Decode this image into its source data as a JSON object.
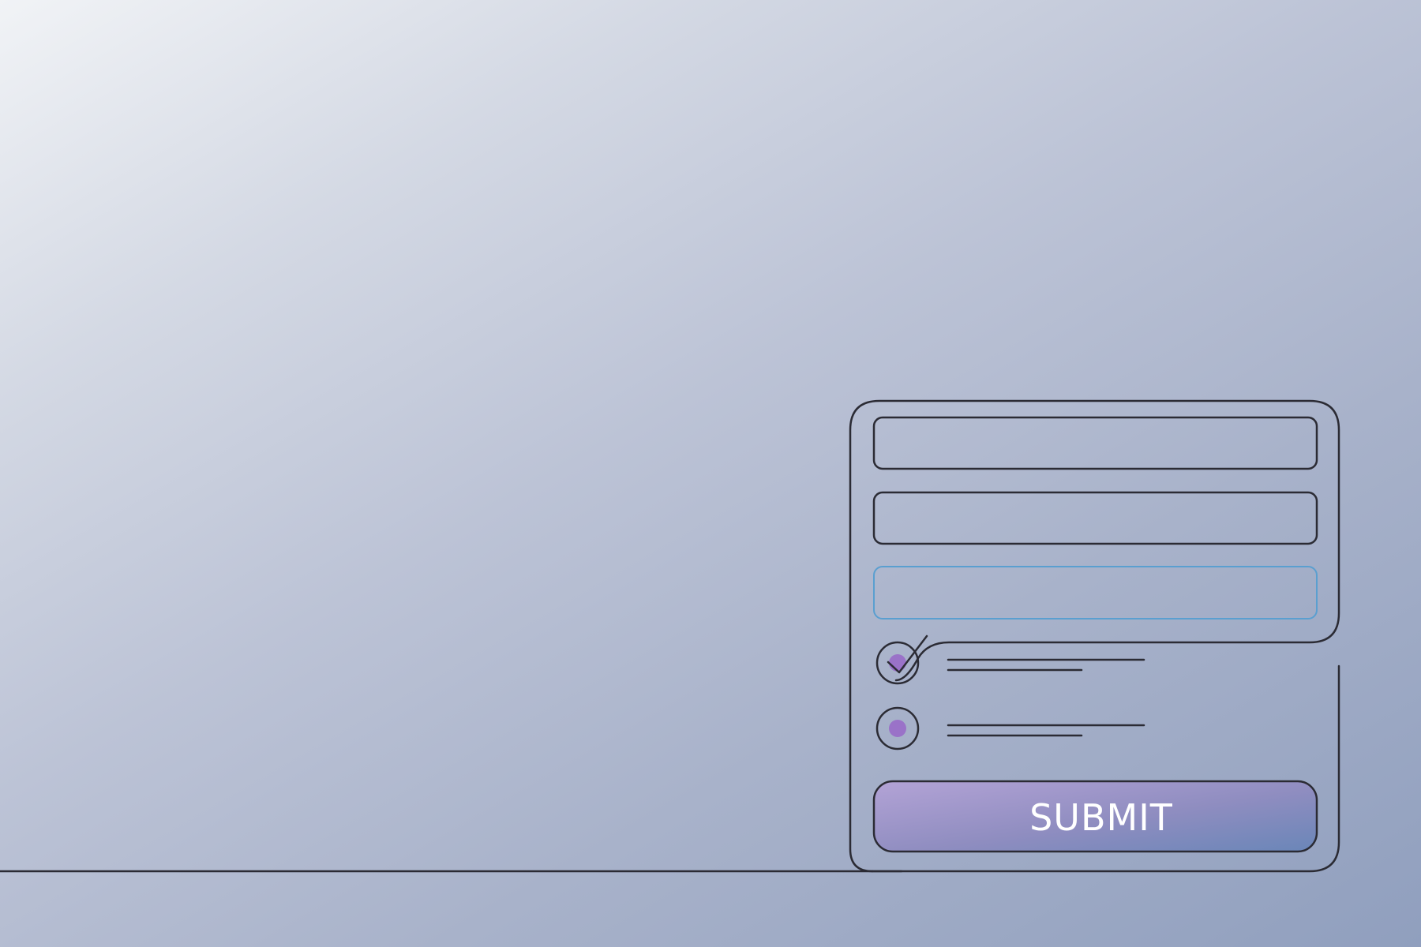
{
  "form": {
    "submit_label": "SUBMIT",
    "fields": [
      {
        "name": "text-field-1",
        "value": ""
      },
      {
        "name": "text-field-2",
        "value": ""
      },
      {
        "name": "text-field-3",
        "value": "",
        "state": "focused"
      }
    ],
    "options": [
      {
        "name": "option-1",
        "state": "checked",
        "icon": "checkmark-icon"
      },
      {
        "name": "option-2",
        "state": "selected"
      }
    ]
  },
  "colors": {
    "background_start": "#f1f3f6",
    "background_end": "#909fbe",
    "outline": "#2b2b34",
    "focus_border": "#5a9fd0",
    "accent_purple": "#9a72c8",
    "button_gradient_start": "#b3a3d6",
    "button_gradient_end": "#6a86b8",
    "button_text": "#ffffff"
  }
}
